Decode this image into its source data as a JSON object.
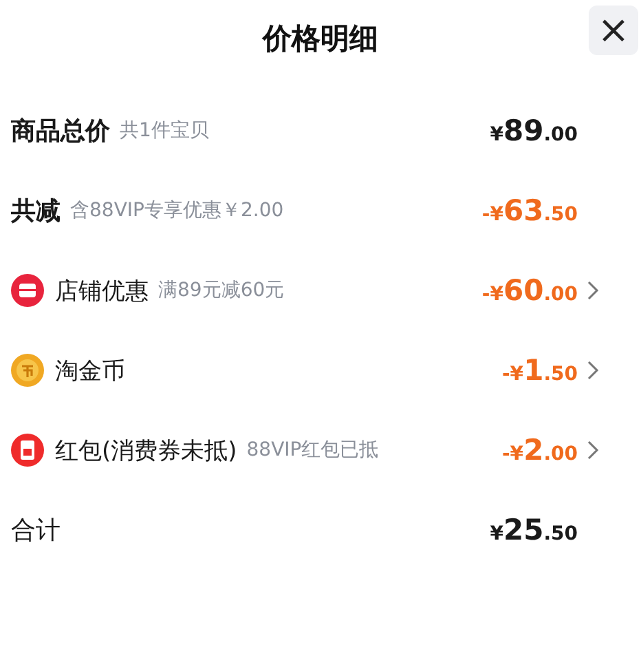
{
  "title": "价格明细",
  "close": {
    "label": "×"
  },
  "rows": [
    {
      "kind": "heading",
      "label": "商品总价",
      "note": "共1件宝贝",
      "price": {
        "currency": "¥",
        "main": "89",
        "fraction": ".00"
      },
      "discount": false,
      "arrow": false
    },
    {
      "kind": "heading",
      "label": "共减",
      "note": "含88VIP专享优惠￥2.00",
      "price": {
        "currency": "-¥",
        "main": "63",
        "fraction": ".50"
      },
      "discount": true,
      "arrow": false
    },
    {
      "kind": "shop",
      "label": "店铺优惠",
      "note": "满89元减60元",
      "price": {
        "currency": "-¥",
        "main": "60",
        "fraction": ".00"
      },
      "discount": true,
      "arrow": true
    },
    {
      "kind": "coin",
      "label": "淘金币",
      "price": {
        "currency": "-¥",
        "main": "1",
        "fraction": ".50"
      },
      "discount": true,
      "arrow": true
    },
    {
      "kind": "packet",
      "label": "红包(消费券未抵)",
      "note": "88VIP红包已抵",
      "price": {
        "currency": "-¥",
        "main": "2",
        "fraction": ".00"
      },
      "discount": true,
      "arrow": true
    },
    {
      "kind": "total",
      "label": "合计",
      "price": {
        "currency": "¥",
        "main": "25",
        "fraction": ".50"
      },
      "discount": false,
      "arrow": false
    }
  ]
}
